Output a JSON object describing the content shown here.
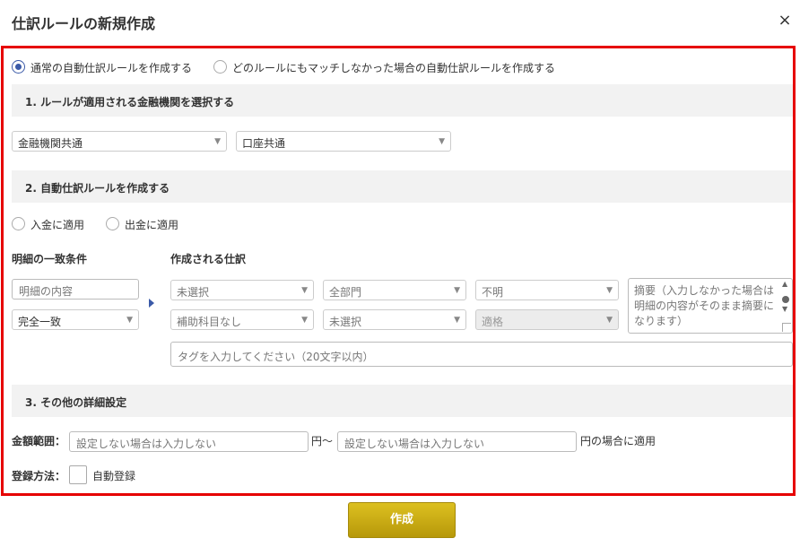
{
  "modal": {
    "title": "仕訳ルールの新規作成",
    "close_glyph": "×"
  },
  "rule_type": {
    "options": [
      {
        "label": "通常の自動仕訳ルールを作成する",
        "selected": true
      },
      {
        "label": "どのルールにもマッチしなかった場合の自動仕訳ルールを作成する",
        "selected": false
      }
    ]
  },
  "section1": {
    "title": "1. ルールが適用される金融機関を選択する",
    "institution_select": "金融機関共通",
    "account_select": "口座共通"
  },
  "section2": {
    "title": "2. 自動仕訳ルールを作成する",
    "direction": [
      {
        "label": "入金に適用",
        "selected": false
      },
      {
        "label": "出金に適用",
        "selected": false
      }
    ],
    "match_heading": "明細の一致条件",
    "entry_heading": "作成される仕訳",
    "detail_placeholder": "明細の内容",
    "match_type": "完全一致",
    "account_item": "未選択",
    "sub_account": "補助科目なし",
    "department": "全部門",
    "department2": "未選択",
    "tax": "不明",
    "tax2": "適格",
    "memo_placeholder": "摘要（入力しなかった場合は明細の内容がそのまま摘要になります）",
    "tag_placeholder": "タグを入力してください（20文字以内）"
  },
  "section3": {
    "title": "3. その他の詳細設定",
    "amount_label": "金額範囲：",
    "amount_min_placeholder": "設定しない場合は入力しない",
    "amount_sep": "円〜",
    "amount_max_placeholder": "設定しない場合は入力しない",
    "amount_suffix": "円の場合に適用",
    "registration_label": "登録方法：",
    "auto_register_label": "自動登録"
  },
  "actions": {
    "create_label": "作成"
  },
  "colors": {
    "frame": "#e60000",
    "accent": "#3b5aa8",
    "button": "#c9ab12"
  },
  "icons": {
    "close": "close-icon",
    "dropdown": "chevron-down-icon",
    "arrow": "arrow-right-icon"
  }
}
